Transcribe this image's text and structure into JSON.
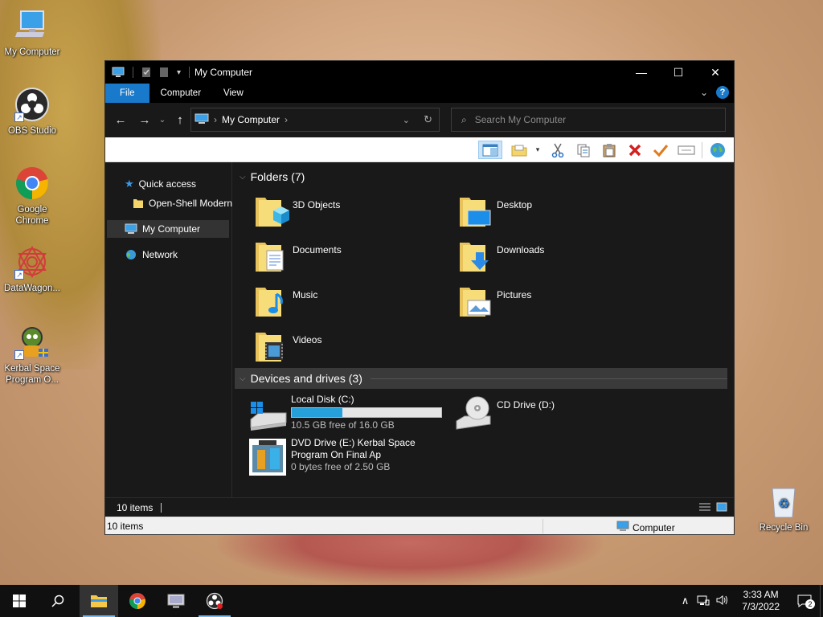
{
  "desktop": {
    "icons": [
      {
        "label": "My Computer"
      },
      {
        "label": "OBS Studio"
      },
      {
        "label": "Google Chrome"
      },
      {
        "label": "DataWagon..."
      },
      {
        "label": "Kerbal Space Program O..."
      },
      {
        "label": "Recycle Bin"
      }
    ]
  },
  "window": {
    "title": "My Computer",
    "controls": {
      "minimize": "—",
      "maximize": "☐",
      "close": "✕"
    },
    "ribbon_tabs": [
      "File",
      "Computer",
      "View"
    ],
    "address": {
      "location": "My Computer"
    },
    "search": {
      "placeholder": "Search My Computer"
    },
    "nav_pane": [
      {
        "label": "Quick access"
      },
      {
        "label": "Open-Shell Modern"
      },
      {
        "label": "My Computer"
      },
      {
        "label": "Network"
      }
    ],
    "folders_group": "Folders (7)",
    "folders": [
      "3D Objects",
      "Desktop",
      "Documents",
      "Downloads",
      "Music",
      "Pictures",
      "Videos"
    ],
    "devices_group": "Devices and drives (3)",
    "drives": [
      {
        "name": "Local Disk (C:)",
        "free": "10.5 GB free of 16.0 GB",
        "used_fraction": 0.34
      },
      {
        "name": "CD Drive (D:)"
      },
      {
        "name1": "DVD Drive (E:) Kerbal Space",
        "name2": "Program On Final Ap",
        "free": "0 bytes free of 2.50 GB"
      }
    ],
    "status_dark": "10 items",
    "status_light": {
      "left": "10 items",
      "right": "Computer"
    }
  },
  "taskbar": {
    "time": "3:33 AM",
    "date": "7/3/2022",
    "notifications": "2"
  }
}
